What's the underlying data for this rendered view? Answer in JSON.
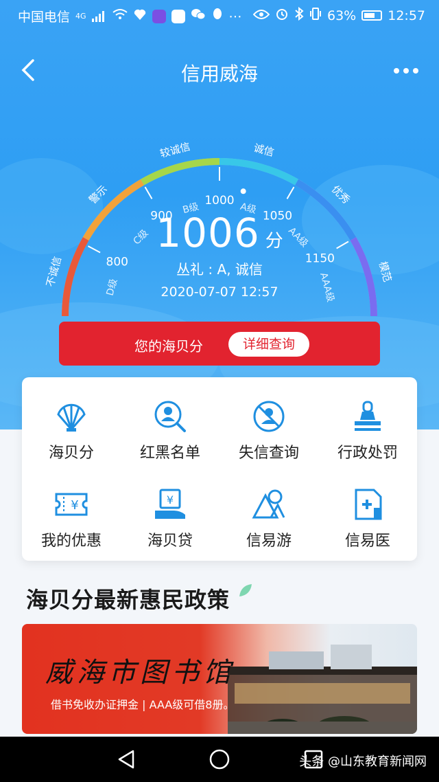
{
  "status_bar": {
    "carrier": "中国电信",
    "network": "4G",
    "battery_percent": "63%",
    "time": "12:57"
  },
  "header": {
    "title": "信用威海"
  },
  "gauge": {
    "levels": [
      "不诚信",
      "警示",
      "较诚信",
      "诚信",
      "优秀",
      "模范"
    ],
    "grades": [
      "D级",
      "C级",
      "B级",
      "A级",
      "AA级",
      "AAA级"
    ],
    "ticks": [
      "800",
      "900",
      "1000",
      "1050",
      "1150"
    ],
    "score": "1006",
    "score_unit": "分",
    "subtitle": "丛礼 : A, 诚信",
    "date": "2020-07-07 12:57",
    "score_fraction": 0.56
  },
  "score_bar": {
    "label": "您的海贝分",
    "button": "详细查询"
  },
  "features": [
    {
      "label": "海贝分",
      "icon": "shell-icon"
    },
    {
      "label": "红黑名单",
      "icon": "user-search-icon"
    },
    {
      "label": "失信查询",
      "icon": "user-forbidden-icon"
    },
    {
      "label": "行政处罚",
      "icon": "stamp-icon"
    },
    {
      "label": "我的优惠",
      "icon": "coupon-icon"
    },
    {
      "label": "海贝贷",
      "icon": "loan-icon"
    },
    {
      "label": "信易游",
      "icon": "mountain-icon"
    },
    {
      "label": "信易医",
      "icon": "medical-icon"
    }
  ],
  "section": {
    "title": "海贝分最新惠民政策"
  },
  "banner": {
    "title": "威海市图书馆",
    "subtitle": "借书免收办证押金 | AAA级可借8册。"
  },
  "watermark": "头条 @山东教育新闻网",
  "colors": {
    "accent": "#2e9ef3",
    "red": "#e2232f",
    "icon_blue": "#1f8fe0"
  }
}
